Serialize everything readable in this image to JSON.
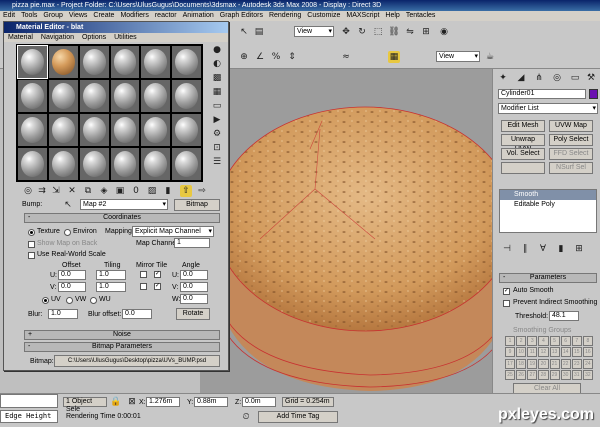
{
  "app": {
    "title": "pizza pie.max  -  Project Folder: C:\\Users\\UlusGugus\\Documents\\3dsmax  -  Autodesk 3ds Max 2008  - Display : Direct 3D"
  },
  "menu": [
    "Edit",
    "Tools",
    "Group",
    "Views",
    "Create",
    "Modifiers",
    "reactor",
    "Animation",
    "Graph Editors",
    "Rendering",
    "Customize",
    "MAXScript",
    "Help",
    "Tentacles"
  ],
  "toolbar": {
    "view1": "View",
    "view2": "View"
  },
  "material_editor": {
    "title": "Material Editor - blat",
    "menu": [
      "Material",
      "Navigation",
      "Options",
      "Utilities"
    ],
    "bump_label": "Bump:",
    "map_name": "Map #2",
    "map_type": "Bitmap",
    "coordinates": {
      "title": "Coordinates",
      "texture": "Texture",
      "environ": "Environ",
      "mapping_label": "Mapping:",
      "mapping": "Explicit Map Channel",
      "show_map": "Show Map on Back",
      "map_channel_label": "Map Channel:",
      "map_channel": "1",
      "real_world": "Use Real-World Scale",
      "offset": "Offset",
      "tiling": "Tiling",
      "mirror_tile": "Mirror Tile",
      "angle": "Angle",
      "u": "U:",
      "v": "V:",
      "w": "W:",
      "u_off": "0.0",
      "v_off": "0.0",
      "u_tile": "1.0",
      "v_tile": "1.0",
      "u_ang": "0.0",
      "v_ang": "0.0",
      "w_ang": "0.0",
      "uv": "UV",
      "vw": "VW",
      "wu": "WU",
      "blur_label": "Blur:",
      "blur": "1.0",
      "blur_offset_label": "Blur offset:",
      "blur_offset": "0.0",
      "rotate": "Rotate"
    },
    "noise": "Noise",
    "bitmap_params": "Bitmap Parameters",
    "bitmap_label": "Bitmap:",
    "bitmap_path": "C:\\Users\\UlusGugus\\Desktop\\pizza\\UVs_BUMP.psd"
  },
  "command_panel": {
    "object": "Cylinder01",
    "modifier_list": "Modifier List",
    "buttons": [
      "Edit Mesh",
      "UVW Map",
      "Unwrap UVW",
      "Poly Select",
      "Vol. Select",
      "FFD Select",
      "",
      "NSurf Sel"
    ],
    "stack": [
      "Smooth",
      "Editable Poly"
    ],
    "parameters": "Parameters",
    "auto_smooth": "Auto Smooth",
    "prevent": "Prevent Indirect Smoothing",
    "threshold_label": "Threshold:",
    "threshold": "48.1",
    "groups": "Smoothing Groups",
    "group_numbers": [
      "1",
      "2",
      "3",
      "4",
      "5",
      "6",
      "7",
      "8",
      "9",
      "10",
      "11",
      "12",
      "13",
      "14",
      "15",
      "16",
      "17",
      "18",
      "19",
      "20",
      "21",
      "22",
      "23",
      "24",
      "25",
      "26",
      "27",
      "28",
      "29",
      "30",
      "31",
      "32"
    ],
    "clear_all": "Clear All"
  },
  "status": {
    "listener": "Edge Height",
    "objects": "1 Object Sele",
    "x_label": "X:",
    "x": "1.276m",
    "y_label": "Y:",
    "y": "0.88m",
    "z_label": "Z:",
    "z": "0.0m",
    "grid": "Grid = 0.254m",
    "render_time": "Rendering Time  0:00:01",
    "add_time_tag": "Add Time Tag"
  },
  "watermark": "pxleyes.com",
  "colors": {
    "accent": "#0a246a",
    "pizza_base": "#d6a56e",
    "wire": "#c83030"
  }
}
